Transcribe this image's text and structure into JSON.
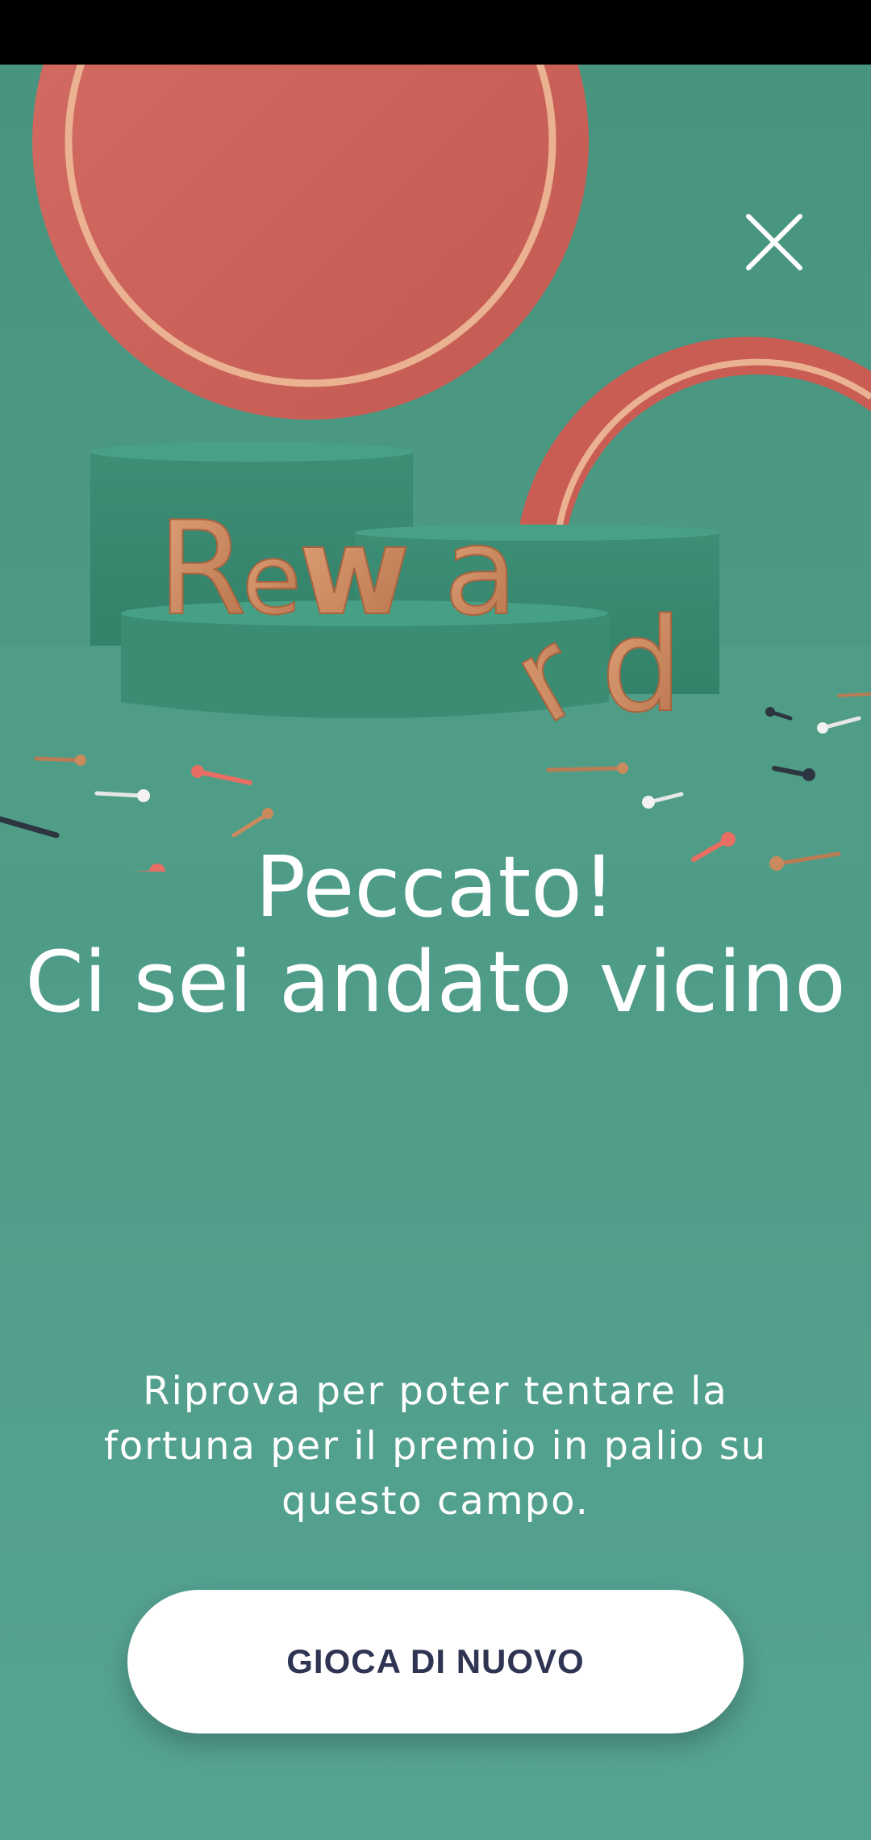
{
  "status_bar": {},
  "hero": {
    "image_name": "reward-illustration",
    "logo_text": "Reward",
    "colors": {
      "background": "#4a977f",
      "coral": "#cc5f57",
      "podium": "#3f8f76",
      "gold": "#c98a5e"
    }
  },
  "close": {
    "icon": "close-icon"
  },
  "headline": {
    "line1": "Peccato!",
    "line2": "Ci sei andato vicino"
  },
  "description": "Riprova per poter tentare la fortuna per il premio in palio su questo campo.",
  "play_button": {
    "label": "GIOCA DI NUOVO"
  }
}
